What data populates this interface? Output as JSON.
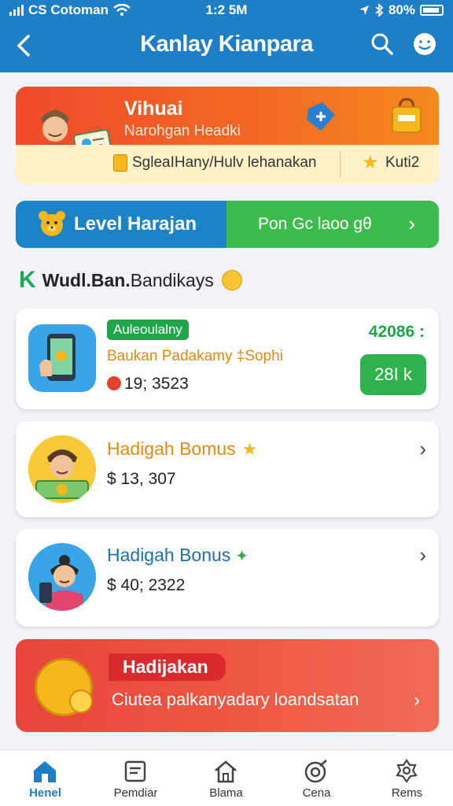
{
  "status": {
    "carrier": "CS Cotoman",
    "time": "1:2 5M",
    "battery": "80%"
  },
  "header": {
    "title": "Kanlay Kianpara"
  },
  "banner": {
    "title": "Vihuai",
    "subtitle": "Narohgan Headki",
    "strip_label": "SgleaIHany/Hulv lehanakan",
    "strip_right": "Kuti2"
  },
  "level": {
    "left_label": "Level Harajan",
    "right_label": "Pon Gc laoo gθ"
  },
  "section": {
    "prefix": "Wudl.Ban.",
    "rest": "Bandikays"
  },
  "cards": [
    {
      "tag": "Auleoulalny",
      "desc": "Baukan Padakamy ‡Sophi",
      "amount": "19; 3523",
      "right_value": "42086 :",
      "button": "28I k"
    },
    {
      "title": "Hadigah Bomus",
      "amount": "$ 13, 307"
    },
    {
      "title": "Hadigah Bonus",
      "amount": "$ 40; 2322"
    }
  ],
  "promo": {
    "title": "Hadijakan",
    "subtitle": "Ciutea palkanyadary loandsatan"
  },
  "nav": [
    {
      "label": "Henel",
      "icon": "home-icon",
      "active": true
    },
    {
      "label": "Pemdiar",
      "icon": "document-icon",
      "active": false
    },
    {
      "label": "Blama",
      "icon": "house-icon",
      "active": false
    },
    {
      "label": "Cena",
      "icon": "target-icon",
      "active": false
    },
    {
      "label": "Rems",
      "icon": "settings-icon",
      "active": false
    }
  ],
  "colors": {
    "primary": "#1e7fc6",
    "green": "#3dbb4e",
    "orange": "#f36b23",
    "red": "#e8453a"
  }
}
